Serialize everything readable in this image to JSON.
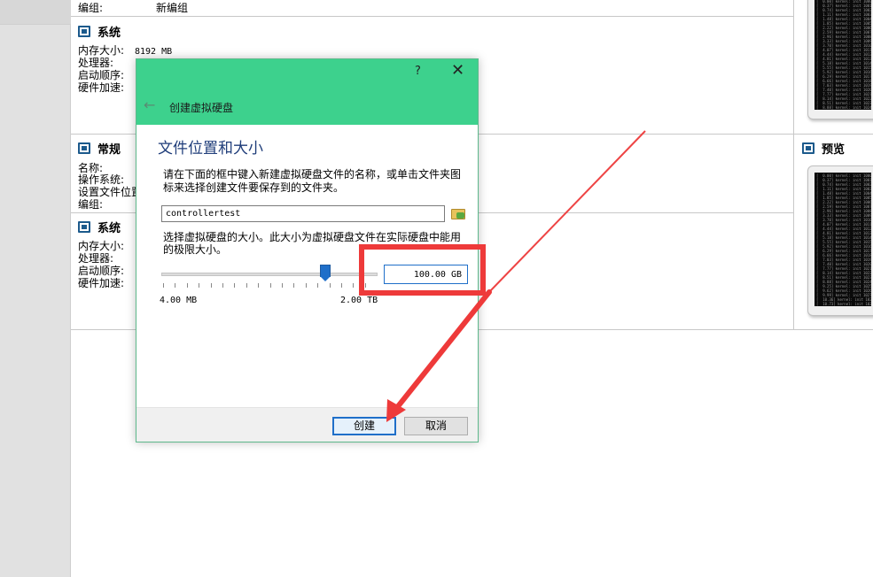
{
  "top_section": {
    "group_label": "编组:",
    "group_value": "新编组"
  },
  "system1": {
    "title": "系统",
    "memory_label": "内存大小:",
    "memory_value": "8192 MB",
    "processor_label": "处理器:",
    "boot_label": "启动顺序:",
    "accel_label": "硬件加速:"
  },
  "general": {
    "title": "常规",
    "name_label": "名称:",
    "os_label": "操作系统:",
    "settings_label": "设置文件位置",
    "group_label": "编组:"
  },
  "system2": {
    "title": "系统",
    "memory_label": "内存大小:",
    "processor_label": "处理器:",
    "boot_label": "启动顺序:",
    "accel_label": "硬件加速:"
  },
  "preview": {
    "title": "预览"
  },
  "dialog": {
    "help": "?",
    "close": "✕",
    "back": "←",
    "title": "创建虚拟硬盘",
    "page_title": "文件位置和大小",
    "file_desc": "请在下面的框中键入新建虚拟硬盘文件的名称，或单击文件夹图标来选择创建文件要保存到的文件夹。",
    "file_name": "controllertest",
    "size_desc": "选择虚拟硬盘的大小。此大小为虚拟硬盘文件在实际硬盘中能用的极限大小。",
    "slider_value": 0.758,
    "slider_min": "4.00 MB",
    "slider_max": "2.00 TB",
    "size_value": "100.00 GB",
    "create_button": "创建",
    "cancel_button": "取消"
  },
  "colors": {
    "dialog_header": "#3dd18d",
    "highlight": "#ee3a3a",
    "accent": "#1f6fc9"
  }
}
